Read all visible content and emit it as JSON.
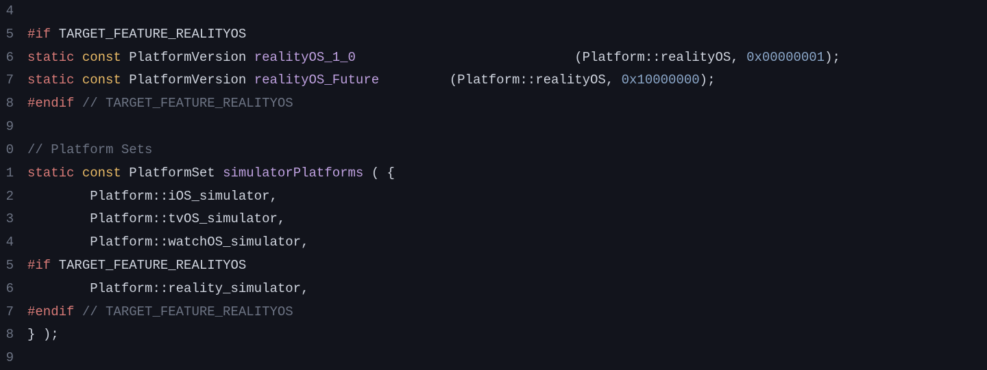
{
  "lines": [
    {
      "num": "4",
      "segments": []
    },
    {
      "num": "5",
      "segments": [
        {
          "cls": "kw1",
          "t": "#if"
        },
        {
          "cls": "plain",
          "t": " "
        },
        {
          "cls": "macro",
          "t": "TARGET_FEATURE_REALITYOS"
        }
      ]
    },
    {
      "num": "6",
      "segments": [
        {
          "cls": "kw1",
          "t": "static"
        },
        {
          "cls": "plain",
          "t": " "
        },
        {
          "cls": "kw2",
          "t": "const"
        },
        {
          "cls": "plain",
          "t": " "
        },
        {
          "cls": "type",
          "t": "PlatformVersion"
        },
        {
          "cls": "plain",
          "t": " "
        },
        {
          "cls": "ident",
          "t": "realityOS_1_0"
        },
        {
          "cls": "plain",
          "t": "                            "
        },
        {
          "cls": "paren",
          "t": "("
        },
        {
          "cls": "namespace",
          "t": "Platform"
        },
        {
          "cls": "scope",
          "t": "::"
        },
        {
          "cls": "namespace",
          "t": "realityOS"
        },
        {
          "cls": "plain",
          "t": ", "
        },
        {
          "cls": "num",
          "t": "0x00000001"
        },
        {
          "cls": "paren",
          "t": ")"
        },
        {
          "cls": "semi",
          "t": ";"
        }
      ]
    },
    {
      "num": "7",
      "segments": [
        {
          "cls": "kw1",
          "t": "static"
        },
        {
          "cls": "plain",
          "t": " "
        },
        {
          "cls": "kw2",
          "t": "const"
        },
        {
          "cls": "plain",
          "t": " "
        },
        {
          "cls": "type",
          "t": "PlatformVersion"
        },
        {
          "cls": "plain",
          "t": " "
        },
        {
          "cls": "ident",
          "t": "realityOS_Future"
        },
        {
          "cls": "plain",
          "t": "         "
        },
        {
          "cls": "paren",
          "t": "("
        },
        {
          "cls": "namespace",
          "t": "Platform"
        },
        {
          "cls": "scope",
          "t": "::"
        },
        {
          "cls": "namespace",
          "t": "realityOS"
        },
        {
          "cls": "plain",
          "t": ", "
        },
        {
          "cls": "num",
          "t": "0x10000000"
        },
        {
          "cls": "paren",
          "t": ")"
        },
        {
          "cls": "semi",
          "t": ";"
        }
      ]
    },
    {
      "num": "8",
      "segments": [
        {
          "cls": "kw1",
          "t": "#endif"
        },
        {
          "cls": "plain",
          "t": " "
        },
        {
          "cls": "comment",
          "t": "// TARGET_FEATURE_REALITYOS"
        }
      ]
    },
    {
      "num": "9",
      "segments": []
    },
    {
      "num": "0",
      "segments": [
        {
          "cls": "comment",
          "t": "// Platform Sets"
        }
      ]
    },
    {
      "num": "1",
      "segments": [
        {
          "cls": "kw1",
          "t": "static"
        },
        {
          "cls": "plain",
          "t": " "
        },
        {
          "cls": "kw2",
          "t": "const"
        },
        {
          "cls": "plain",
          "t": " "
        },
        {
          "cls": "type",
          "t": "PlatformSet"
        },
        {
          "cls": "plain",
          "t": " "
        },
        {
          "cls": "ident",
          "t": "simulatorPlatforms"
        },
        {
          "cls": "plain",
          "t": " "
        },
        {
          "cls": "paren",
          "t": "("
        },
        {
          "cls": "plain",
          "t": " "
        },
        {
          "cls": "paren",
          "t": "{"
        }
      ]
    },
    {
      "num": "2",
      "segments": [
        {
          "cls": "plain",
          "t": "        "
        },
        {
          "cls": "namespace",
          "t": "Platform"
        },
        {
          "cls": "scope",
          "t": "::"
        },
        {
          "cls": "namespace",
          "t": "iOS_simulator"
        },
        {
          "cls": "plain",
          "t": ","
        }
      ]
    },
    {
      "num": "3",
      "segments": [
        {
          "cls": "plain",
          "t": "        "
        },
        {
          "cls": "namespace",
          "t": "Platform"
        },
        {
          "cls": "scope",
          "t": "::"
        },
        {
          "cls": "namespace",
          "t": "tvOS_simulator"
        },
        {
          "cls": "plain",
          "t": ","
        }
      ]
    },
    {
      "num": "4",
      "segments": [
        {
          "cls": "plain",
          "t": "        "
        },
        {
          "cls": "namespace",
          "t": "Platform"
        },
        {
          "cls": "scope",
          "t": "::"
        },
        {
          "cls": "namespace",
          "t": "watchOS_simulator"
        },
        {
          "cls": "plain",
          "t": ","
        }
      ]
    },
    {
      "num": "5",
      "segments": [
        {
          "cls": "kw1",
          "t": "#if"
        },
        {
          "cls": "plain",
          "t": " "
        },
        {
          "cls": "macro",
          "t": "TARGET_FEATURE_REALITYOS"
        }
      ]
    },
    {
      "num": "6",
      "segments": [
        {
          "cls": "plain",
          "t": "        "
        },
        {
          "cls": "namespace",
          "t": "Platform"
        },
        {
          "cls": "scope",
          "t": "::"
        },
        {
          "cls": "namespace",
          "t": "reality_simulator"
        },
        {
          "cls": "plain",
          "t": ","
        }
      ]
    },
    {
      "num": "7",
      "segments": [
        {
          "cls": "kw1",
          "t": "#endif"
        },
        {
          "cls": "plain",
          "t": " "
        },
        {
          "cls": "comment",
          "t": "// TARGET_FEATURE_REALITYOS"
        }
      ]
    },
    {
      "num": "8",
      "segments": [
        {
          "cls": "paren",
          "t": "}"
        },
        {
          "cls": "plain",
          "t": " "
        },
        {
          "cls": "paren",
          "t": ")"
        },
        {
          "cls": "semi",
          "t": ";"
        }
      ]
    },
    {
      "num": "9",
      "segments": []
    }
  ]
}
